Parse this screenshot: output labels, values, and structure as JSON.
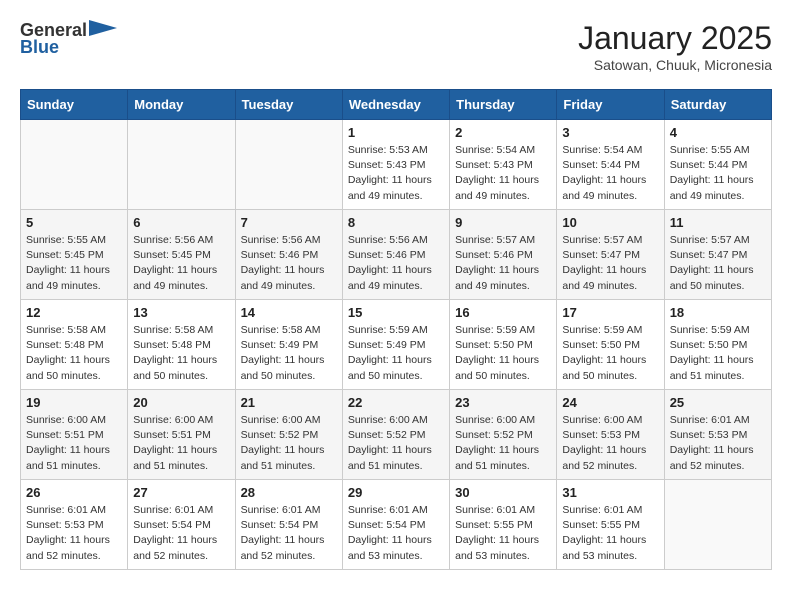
{
  "header": {
    "logo_general": "General",
    "logo_blue": "Blue",
    "month": "January 2025",
    "location": "Satowan, Chuuk, Micronesia"
  },
  "weekdays": [
    "Sunday",
    "Monday",
    "Tuesday",
    "Wednesday",
    "Thursday",
    "Friday",
    "Saturday"
  ],
  "weeks": [
    [
      {
        "day": "",
        "info": ""
      },
      {
        "day": "",
        "info": ""
      },
      {
        "day": "",
        "info": ""
      },
      {
        "day": "1",
        "info": "Sunrise: 5:53 AM\nSunset: 5:43 PM\nDaylight: 11 hours\nand 49 minutes."
      },
      {
        "day": "2",
        "info": "Sunrise: 5:54 AM\nSunset: 5:43 PM\nDaylight: 11 hours\nand 49 minutes."
      },
      {
        "day": "3",
        "info": "Sunrise: 5:54 AM\nSunset: 5:44 PM\nDaylight: 11 hours\nand 49 minutes."
      },
      {
        "day": "4",
        "info": "Sunrise: 5:55 AM\nSunset: 5:44 PM\nDaylight: 11 hours\nand 49 minutes."
      }
    ],
    [
      {
        "day": "5",
        "info": "Sunrise: 5:55 AM\nSunset: 5:45 PM\nDaylight: 11 hours\nand 49 minutes."
      },
      {
        "day": "6",
        "info": "Sunrise: 5:56 AM\nSunset: 5:45 PM\nDaylight: 11 hours\nand 49 minutes."
      },
      {
        "day": "7",
        "info": "Sunrise: 5:56 AM\nSunset: 5:46 PM\nDaylight: 11 hours\nand 49 minutes."
      },
      {
        "day": "8",
        "info": "Sunrise: 5:56 AM\nSunset: 5:46 PM\nDaylight: 11 hours\nand 49 minutes."
      },
      {
        "day": "9",
        "info": "Sunrise: 5:57 AM\nSunset: 5:46 PM\nDaylight: 11 hours\nand 49 minutes."
      },
      {
        "day": "10",
        "info": "Sunrise: 5:57 AM\nSunset: 5:47 PM\nDaylight: 11 hours\nand 49 minutes."
      },
      {
        "day": "11",
        "info": "Sunrise: 5:57 AM\nSunset: 5:47 PM\nDaylight: 11 hours\nand 50 minutes."
      }
    ],
    [
      {
        "day": "12",
        "info": "Sunrise: 5:58 AM\nSunset: 5:48 PM\nDaylight: 11 hours\nand 50 minutes."
      },
      {
        "day": "13",
        "info": "Sunrise: 5:58 AM\nSunset: 5:48 PM\nDaylight: 11 hours\nand 50 minutes."
      },
      {
        "day": "14",
        "info": "Sunrise: 5:58 AM\nSunset: 5:49 PM\nDaylight: 11 hours\nand 50 minutes."
      },
      {
        "day": "15",
        "info": "Sunrise: 5:59 AM\nSunset: 5:49 PM\nDaylight: 11 hours\nand 50 minutes."
      },
      {
        "day": "16",
        "info": "Sunrise: 5:59 AM\nSunset: 5:50 PM\nDaylight: 11 hours\nand 50 minutes."
      },
      {
        "day": "17",
        "info": "Sunrise: 5:59 AM\nSunset: 5:50 PM\nDaylight: 11 hours\nand 50 minutes."
      },
      {
        "day": "18",
        "info": "Sunrise: 5:59 AM\nSunset: 5:50 PM\nDaylight: 11 hours\nand 51 minutes."
      }
    ],
    [
      {
        "day": "19",
        "info": "Sunrise: 6:00 AM\nSunset: 5:51 PM\nDaylight: 11 hours\nand 51 minutes."
      },
      {
        "day": "20",
        "info": "Sunrise: 6:00 AM\nSunset: 5:51 PM\nDaylight: 11 hours\nand 51 minutes."
      },
      {
        "day": "21",
        "info": "Sunrise: 6:00 AM\nSunset: 5:52 PM\nDaylight: 11 hours\nand 51 minutes."
      },
      {
        "day": "22",
        "info": "Sunrise: 6:00 AM\nSunset: 5:52 PM\nDaylight: 11 hours\nand 51 minutes."
      },
      {
        "day": "23",
        "info": "Sunrise: 6:00 AM\nSunset: 5:52 PM\nDaylight: 11 hours\nand 51 minutes."
      },
      {
        "day": "24",
        "info": "Sunrise: 6:00 AM\nSunset: 5:53 PM\nDaylight: 11 hours\nand 52 minutes."
      },
      {
        "day": "25",
        "info": "Sunrise: 6:01 AM\nSunset: 5:53 PM\nDaylight: 11 hours\nand 52 minutes."
      }
    ],
    [
      {
        "day": "26",
        "info": "Sunrise: 6:01 AM\nSunset: 5:53 PM\nDaylight: 11 hours\nand 52 minutes."
      },
      {
        "day": "27",
        "info": "Sunrise: 6:01 AM\nSunset: 5:54 PM\nDaylight: 11 hours\nand 52 minutes."
      },
      {
        "day": "28",
        "info": "Sunrise: 6:01 AM\nSunset: 5:54 PM\nDaylight: 11 hours\nand 52 minutes."
      },
      {
        "day": "29",
        "info": "Sunrise: 6:01 AM\nSunset: 5:54 PM\nDaylight: 11 hours\nand 53 minutes."
      },
      {
        "day": "30",
        "info": "Sunrise: 6:01 AM\nSunset: 5:55 PM\nDaylight: 11 hours\nand 53 minutes."
      },
      {
        "day": "31",
        "info": "Sunrise: 6:01 AM\nSunset: 5:55 PM\nDaylight: 11 hours\nand 53 minutes."
      },
      {
        "day": "",
        "info": ""
      }
    ]
  ]
}
